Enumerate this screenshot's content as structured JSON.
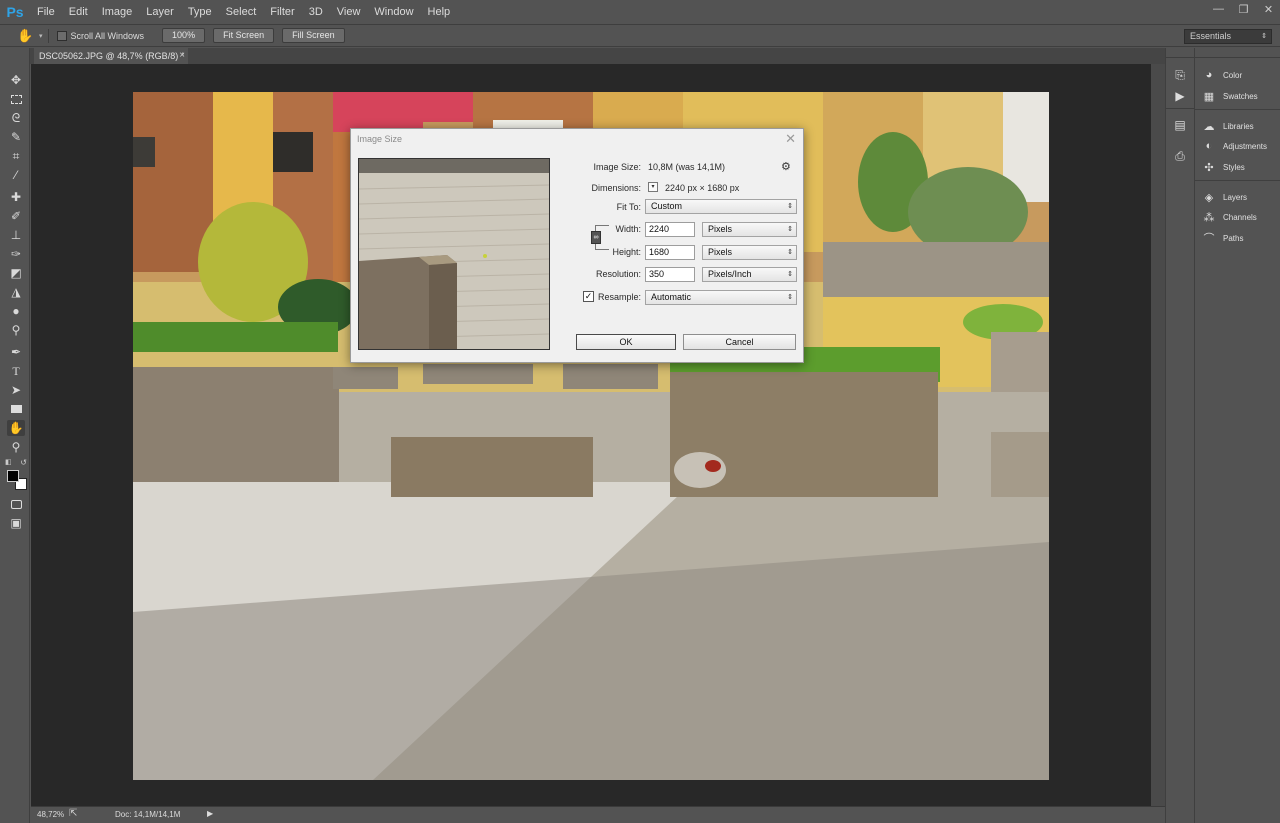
{
  "app": {
    "logo": "Ps"
  },
  "menu": [
    "File",
    "Edit",
    "Image",
    "Layer",
    "Type",
    "Select",
    "Filter",
    "3D",
    "View",
    "Window",
    "Help"
  ],
  "window_controls": {
    "minimize": "—",
    "restore": "❐",
    "close": "✕"
  },
  "options_bar": {
    "scroll_all_label": "Scroll All Windows",
    "btn_100": "100%",
    "btn_fit": "Fit Screen",
    "btn_fill": "Fill Screen",
    "workspace": "Essentials"
  },
  "document_tab": {
    "title": "DSC05062.JPG @ 48,7% (RGB/8) *",
    "close": "×"
  },
  "status_bar": {
    "zoom": "48,72%",
    "doc": "Doc: 14,1M/14,1M"
  },
  "panels": {
    "group1": [
      "Color",
      "Swatches"
    ],
    "group2": [
      "Libraries",
      "Adjustments",
      "Styles"
    ],
    "group3": [
      "Layers",
      "Channels",
      "Paths"
    ]
  },
  "image_size_dialog": {
    "title": "Image Size",
    "image_size_label": "Image Size:",
    "image_size_value": "10,8M (was 14,1M)",
    "dimensions_label": "Dimensions:",
    "dimensions_value": "2240 px  ×  1680 px",
    "fit_to_label": "Fit To:",
    "fit_to_value": "Custom",
    "width_label": "Width:",
    "width_value": "2240",
    "width_unit": "Pixels",
    "height_label": "Height:",
    "height_value": "1680",
    "height_unit": "Pixels",
    "resolution_label": "Resolution:",
    "resolution_value": "350",
    "resolution_unit": "Pixels/Inch",
    "resample_label": "Resample:",
    "resample_checked": true,
    "resample_value": "Automatic",
    "ok_label": "OK",
    "cancel_label": "Cancel"
  },
  "colors": {
    "app_bg": "#535353",
    "canvas_bg": "#282828",
    "ps_blue": "#2fa3e6",
    "dialog_bg": "#f0f0f0"
  }
}
